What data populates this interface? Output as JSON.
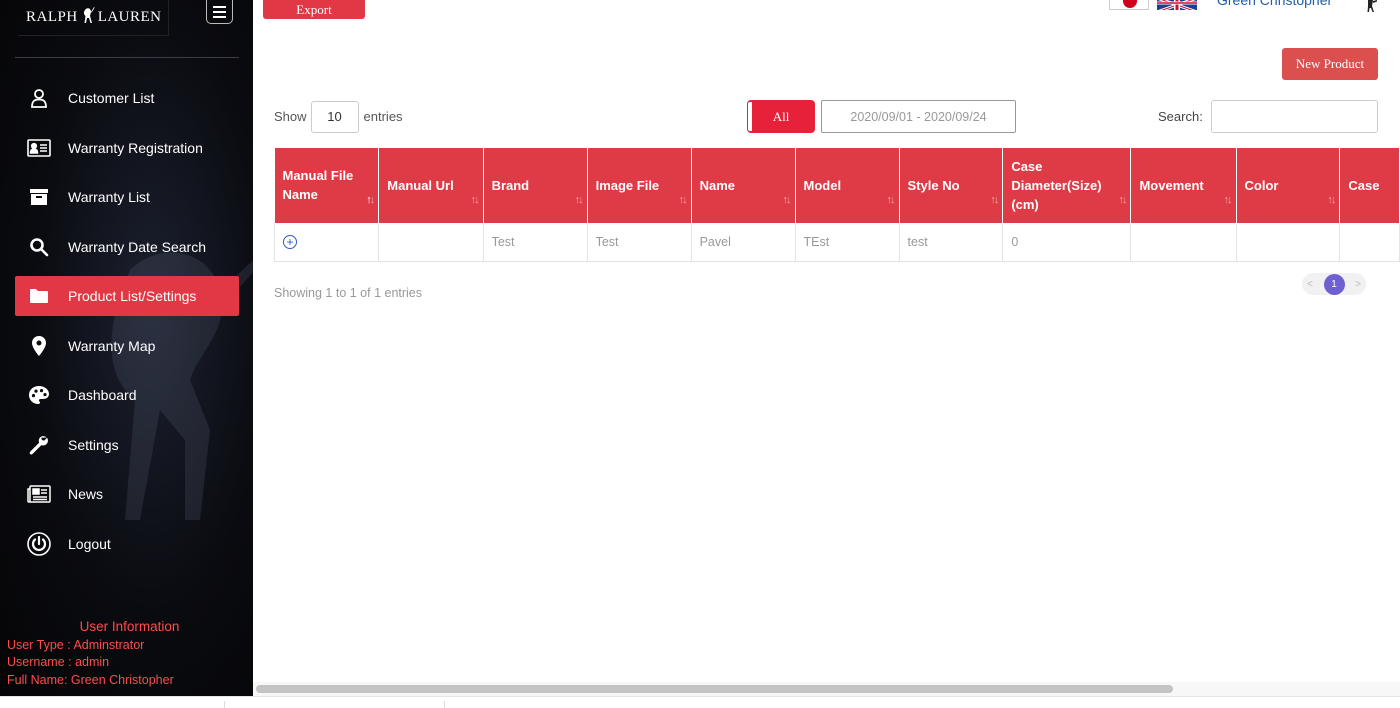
{
  "brand": {
    "logo_left": "RALPH",
    "logo_right": "LAUREN"
  },
  "sidebar": {
    "items": [
      {
        "label": "Customer List",
        "icon": "user-icon"
      },
      {
        "label": "Warranty Registration",
        "icon": "id-card-icon"
      },
      {
        "label": "Warranty List",
        "icon": "archive-icon"
      },
      {
        "label": "Warranty Date Search",
        "icon": "search-icon"
      },
      {
        "label": "Product List/Settings",
        "icon": "folder-icon",
        "active": true
      },
      {
        "label": "Warranty Map",
        "icon": "map-marker-icon"
      },
      {
        "label": "Dashboard",
        "icon": "palette-icon"
      },
      {
        "label": "Settings",
        "icon": "wrench-icon"
      },
      {
        "label": "News",
        "icon": "newspaper-icon"
      },
      {
        "label": "Logout",
        "icon": "power-icon"
      }
    ],
    "user_info": {
      "header": "User Information",
      "user_type": "User Type : Adminstrator",
      "username": "Username : admin",
      "full_name": "Full Name:  Green Christopher"
    }
  },
  "topbar": {
    "export_label": "Export",
    "user_name": "Green Christopher"
  },
  "toolbar": {
    "new_product_label": "New Product",
    "show_label": "Show",
    "entries_value": "10",
    "entries_label": "entries",
    "all_label": "All",
    "date_range": "2020/09/01 - 2020/09/24",
    "search_label": "Search:",
    "search_value": ""
  },
  "table": {
    "columns": [
      "Manual File Name",
      "Manual Url",
      "Brand",
      "Image File",
      "Name",
      "Model",
      "Style No",
      "Case Diameter(Size) (cm)",
      "Movement",
      "Color",
      "Case"
    ],
    "rows": [
      {
        "manual_file_name": "",
        "manual_url": "",
        "brand": "Test",
        "image_file": "Test",
        "name": "Pavel",
        "model": "TEst",
        "style_no": "test",
        "case_diameter": "0",
        "movement": "",
        "color": "",
        "case": ""
      }
    ]
  },
  "footer": {
    "info": "Showing 1 to 1 of 1 entries",
    "prev": "<",
    "page": "1",
    "next": ">"
  },
  "colors": {
    "accent": "#df3b47",
    "active_nav": "#e23745",
    "pager": "#6e60d1",
    "user_info": "#ff4b4b",
    "link": "#1f5ea8"
  }
}
